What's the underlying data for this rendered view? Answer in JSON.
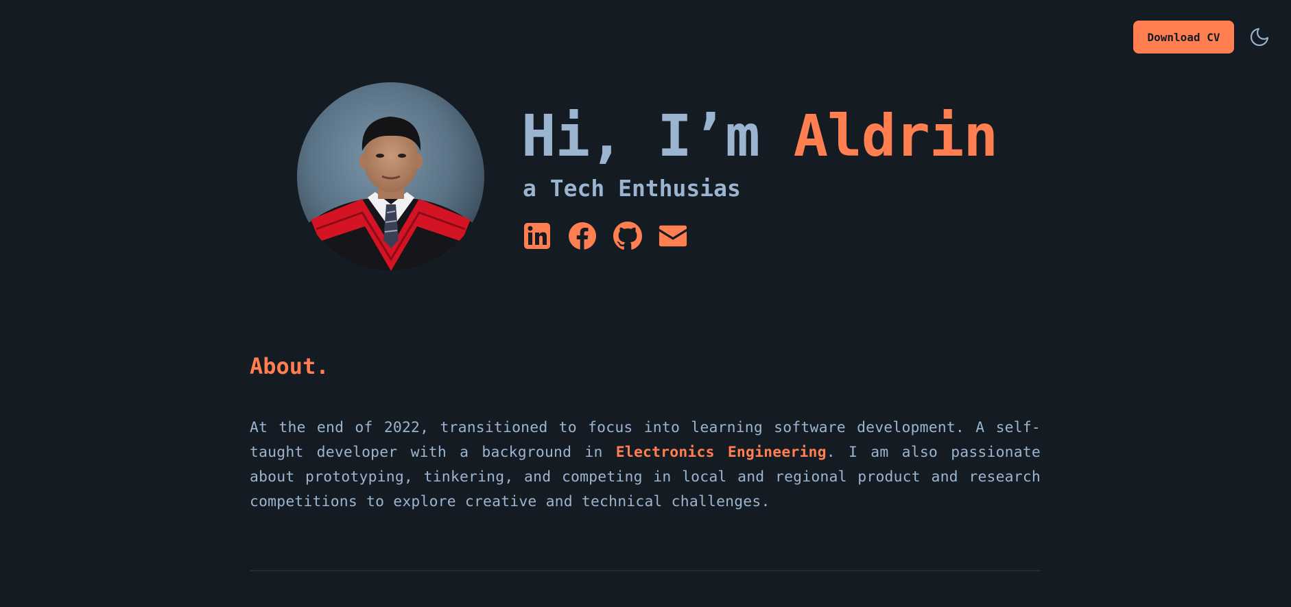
{
  "header": {
    "download_cv_label": "Download CV",
    "theme_toggle_icon": "moon-icon"
  },
  "hero": {
    "greeting": "Hi, I’m ",
    "name": "Aldrin",
    "subtitle": "a Tech Enthusias",
    "socials": [
      {
        "icon": "linkedin-icon"
      },
      {
        "icon": "facebook-icon"
      },
      {
        "icon": "github-icon"
      },
      {
        "icon": "email-icon"
      }
    ]
  },
  "about": {
    "title": "About.",
    "text_before": "At the end of 2022, transitioned to focus into learning software development. A self-taught developer with a background in ",
    "highlight": "Electronics Engineering",
    "text_after": ". I am also passionate about prototyping, tinkering, and competing in local and regional product and research competitions to explore creative and technical challenges."
  },
  "colors": {
    "background": "#151b23",
    "accent": "#ff7f50",
    "text": "#9bb5d0"
  }
}
